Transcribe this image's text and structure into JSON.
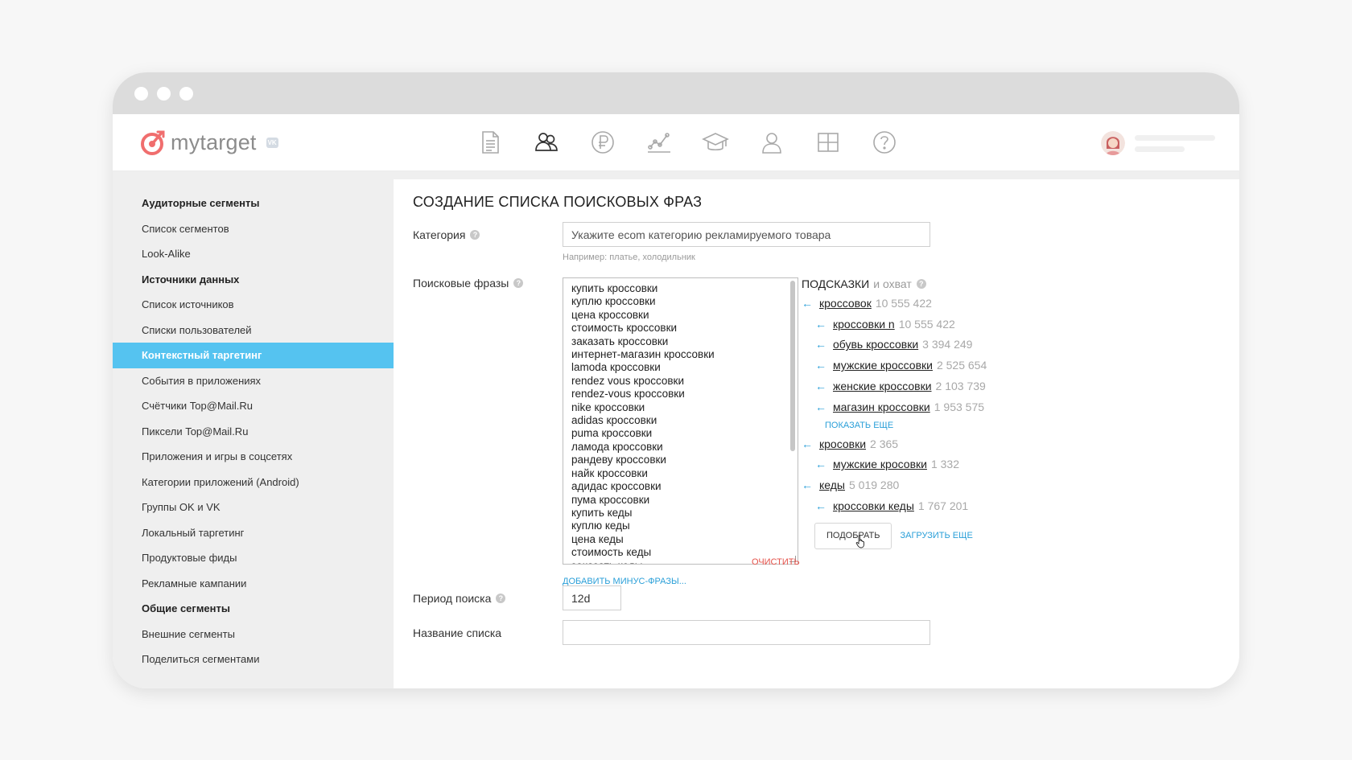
{
  "header": {
    "logo_text": "mytarget",
    "logo_badge": "VK",
    "nav_icons": [
      "document-icon",
      "audience-icon",
      "ruble-icon",
      "stats-icon",
      "education-icon",
      "profile-icon",
      "grid-icon",
      "help-circle-icon"
    ]
  },
  "sidebar": {
    "items": [
      {
        "label": "Аудиторные сегменты",
        "type": "heading"
      },
      {
        "label": "Список сегментов",
        "type": "item"
      },
      {
        "label": "Look-Alike",
        "type": "item"
      },
      {
        "label": "Источники данных",
        "type": "heading"
      },
      {
        "label": "Список источников",
        "type": "item"
      },
      {
        "label": "Списки пользователей",
        "type": "item"
      },
      {
        "label": "Контекстный таргетинг",
        "type": "active"
      },
      {
        "label": "События в приложениях",
        "type": "item"
      },
      {
        "label": "Счётчики Top@Mail.Ru",
        "type": "item"
      },
      {
        "label": "Пиксели Top@Mail.Ru",
        "type": "item"
      },
      {
        "label": "Приложения и игры в соцсетях",
        "type": "item"
      },
      {
        "label": "Категории приложений (Android)",
        "type": "item"
      },
      {
        "label": "Группы OK и VK",
        "type": "item"
      },
      {
        "label": "Локальный таргетинг",
        "type": "item"
      },
      {
        "label": "Продуктовые фиды",
        "type": "item"
      },
      {
        "label": "Рекламные кампании",
        "type": "item"
      },
      {
        "label": "Общие сегменты",
        "type": "heading"
      },
      {
        "label": "Внешние сегменты",
        "type": "item"
      },
      {
        "label": "Поделиться сегментами",
        "type": "item"
      }
    ]
  },
  "main": {
    "title": "СОЗДАНИЕ СПИСКА ПОИСКОВЫХ ФРАЗ",
    "category_label": "Категория",
    "category_placeholder": "Укажите ecom категорию рекламируемого товара",
    "category_hint": "Например: платье, холодильник",
    "phrases_label": "Поисковые фразы",
    "phrases": [
      "купить кроссовки",
      "куплю кроссовки",
      "цена кроссовки",
      "стоимость кроссовки",
      "заказать кроссовки",
      "интернет-магазин кроссовки",
      "lamoda кроссовки",
      "rendez vous кроссовки",
      "rendez-vous кроссовки",
      "nike кроссовки",
      "adidas кроссовки",
      "puma кроссовки",
      "ламода кроссовки",
      "рандеву кроссовки",
      "найк кроссовки",
      "адидас кроссовки",
      "пума кроссовки",
      "купить кеды",
      "куплю кеды",
      "цена кеды",
      "стоимость кеды",
      "заказать кеды"
    ],
    "clear_label": "ОЧИСТИТЬ",
    "add_minus_label": "ДОБАВИТЬ МИНУС-ФРАЗЫ...",
    "period_label": "Период поиска",
    "period_value": "12d",
    "list_name_label": "Название списка",
    "list_name_value": ""
  },
  "suggestions": {
    "title": "ПОДСКАЗКИ",
    "subtitle": "и охват",
    "show_more_label": "ПОКАЗАТЬ ЕЩЕ",
    "pick_label": "ПОДОБРАТЬ",
    "load_more_label": "ЗАГРУЗИТЬ ЕЩЕ",
    "items": [
      {
        "text": "кроссовок",
        "count": "10 555 422",
        "level": 0
      },
      {
        "text": "кроссовки n",
        "count": "10 555 422",
        "level": 1
      },
      {
        "text": "обувь кроссовки",
        "count": "3 394 249",
        "level": 1
      },
      {
        "text": "мужские кроссовки",
        "count": "2 525 654",
        "level": 1
      },
      {
        "text": "женские кроссовки",
        "count": "2 103 739",
        "level": 1
      },
      {
        "text": "магазин кроссовки",
        "count": "1 953 575",
        "level": 1
      },
      {
        "text": "кросовки",
        "count": "2 365",
        "level": 0
      },
      {
        "text": "мужские кросовки",
        "count": "1 332",
        "level": 1
      },
      {
        "text": "кеды",
        "count": "5 019 280",
        "level": 0
      },
      {
        "text": "кроссовки кеды",
        "count": "1 767 201",
        "level": 1
      }
    ]
  },
  "colors": {
    "accent": "#55c3f0",
    "link": "#2a9fd8",
    "danger": "#e5534b",
    "brand": "#f06e6e"
  }
}
